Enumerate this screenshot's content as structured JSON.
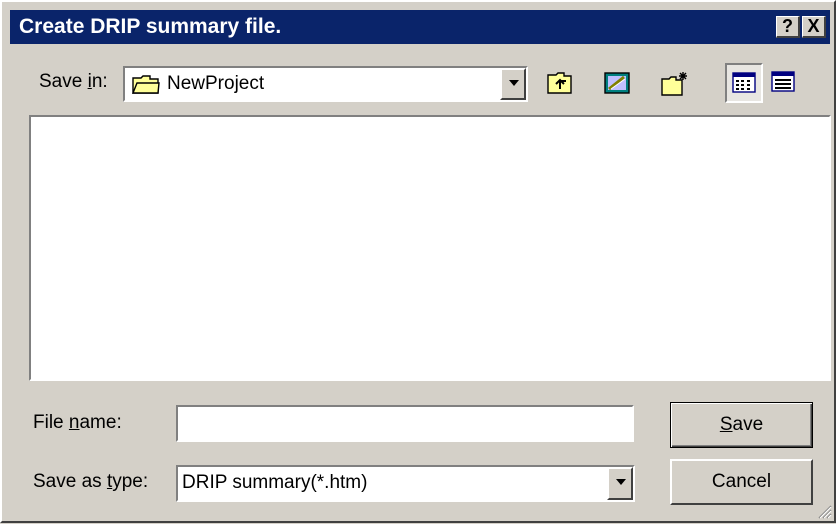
{
  "window": {
    "title": "Create DRIP summary file.",
    "help_label": "?",
    "close_label": "X"
  },
  "save_in": {
    "label_before": "Save ",
    "label_accel": "i",
    "label_after": "n:",
    "folder": "NewProject",
    "folder_icon": "folder-icon"
  },
  "toolbar": {
    "buttons": [
      {
        "name": "up-one-level",
        "icon": "folder-up-icon"
      },
      {
        "name": "desktop",
        "icon": "desktop-icon"
      },
      {
        "name": "create-new-folder",
        "icon": "new-folder-icon"
      },
      {
        "name": "list-view",
        "icon": "list-view-icon",
        "active": true
      },
      {
        "name": "details-view",
        "icon": "details-view-icon"
      }
    ]
  },
  "file_name": {
    "label_before": "File ",
    "label_accel": "n",
    "label_after": "ame:",
    "value": ""
  },
  "save_as_type": {
    "label_before": "Save as ",
    "label_accel": "t",
    "label_after": "ype:",
    "value": "DRIP summary(*.htm)"
  },
  "buttons": {
    "save_accel": "S",
    "save_rest": "ave",
    "cancel": "Cancel"
  },
  "colors": {
    "titlebar": "#0a246a",
    "face": "#d4d0c8",
    "folder_yellow": "#ffff99"
  }
}
